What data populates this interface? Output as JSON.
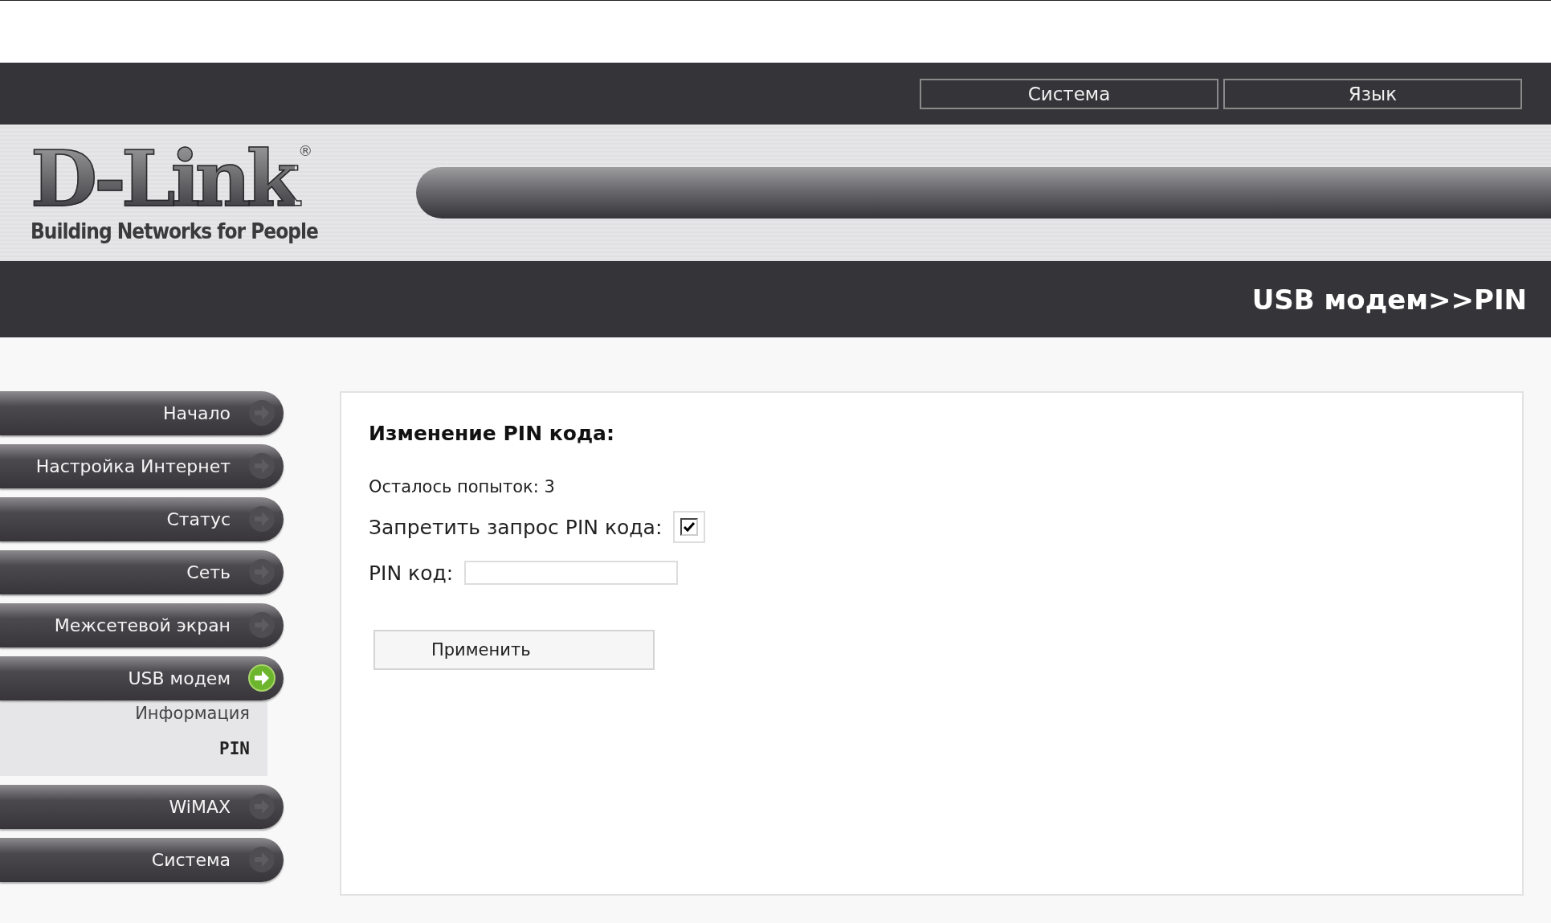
{
  "top_menu": [
    {
      "label": "Система"
    },
    {
      "label": "Язык"
    }
  ],
  "logo": {
    "name": "D-Link",
    "mark": "®",
    "tagline": "Building Networks for People"
  },
  "breadcrumb": "USB модем>>PIN",
  "sidebar": {
    "items": [
      {
        "label": "Начало",
        "selected": false
      },
      {
        "label": "Настройка Интернет",
        "selected": false
      },
      {
        "label": "Статус",
        "selected": false
      },
      {
        "label": "Сеть",
        "selected": false
      },
      {
        "label": "Межсетевой экран",
        "selected": false
      },
      {
        "label": "USB модем",
        "selected": true,
        "children": [
          {
            "label": "Информация",
            "selected": false
          },
          {
            "label": "PIN",
            "selected": true
          }
        ]
      },
      {
        "label": "WiMAX",
        "selected": false
      },
      {
        "label": "Система",
        "selected": false
      }
    ]
  },
  "form": {
    "title": "Изменение PIN кода:",
    "attempts": "Осталось попыток: 3",
    "disable_label": "Запретить запрос PIN кода:",
    "disable_checked": true,
    "pin_label": "PIN код:",
    "apply_button": "Применить"
  }
}
